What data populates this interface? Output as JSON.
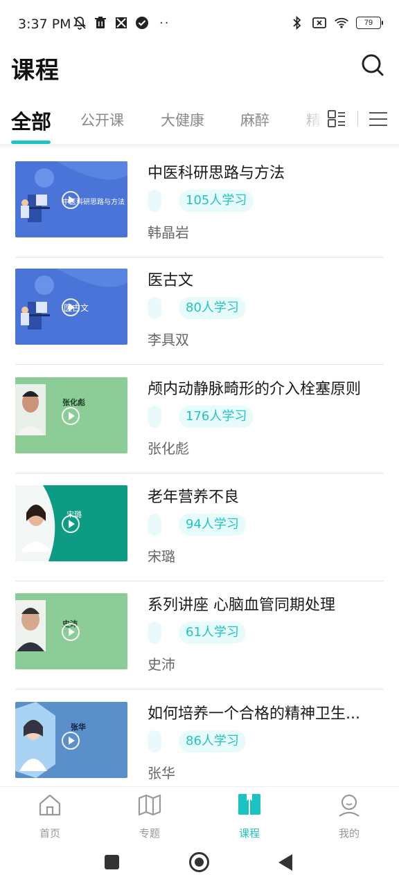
{
  "status_bar": {
    "time": "3:37 PM",
    "left_icons": [
      "mute-icon",
      "trash-icon",
      "app-icon",
      "check-icon"
    ],
    "more": "··",
    "right_icons": [
      "bluetooth-icon",
      "sim-icon",
      "wifi-icon"
    ],
    "battery": "79"
  },
  "header": {
    "title": "课程",
    "search_icon": "search-icon"
  },
  "tabs": [
    {
      "label": "全部",
      "active": true
    },
    {
      "label": "公开课"
    },
    {
      "label": "大健康"
    },
    {
      "label": "麻醉"
    },
    {
      "label": "精"
    }
  ],
  "courses": [
    {
      "title": "中医科研思路与方法",
      "learners": "105人学习",
      "teacher": "韩晶岩",
      "thumb_style": "blue",
      "thumb_text": "中医科研思路与方法"
    },
    {
      "title": "医古文",
      "learners": "80人学习",
      "teacher": "李具双",
      "thumb_style": "blue",
      "thumb_text": "医古文"
    },
    {
      "title": "颅内动静脉畸形的介入栓塞原则",
      "learners": "176人学习",
      "teacher": "张化彪",
      "thumb_style": "green",
      "thumb_text": "张化彪"
    },
    {
      "title": "老年营养不良",
      "learners": "94人学习",
      "teacher": "宋璐",
      "thumb_style": "teal",
      "thumb_text": "宋璐"
    },
    {
      "title": "系列讲座 心脑血管同期处理",
      "learners": "61人学习",
      "teacher": "史沛",
      "thumb_style": "green",
      "thumb_text": "史沛"
    },
    {
      "title": "如何培养一个合格的精神卫生...",
      "learners": "86人学习",
      "teacher": "张华",
      "thumb_style": "steel",
      "thumb_text": "张华"
    }
  ],
  "bottom_nav": [
    {
      "label": "首页",
      "icon": "home-icon"
    },
    {
      "label": "专题",
      "icon": "map-icon"
    },
    {
      "label": "课程",
      "icon": "book-icon",
      "active": true
    },
    {
      "label": "我的",
      "icon": "user-icon"
    }
  ],
  "colors": {
    "accent": "#1cc3c0",
    "thumb_blue": "#4a74d8",
    "thumb_green": "#8ccc96",
    "thumb_teal": "#0d9b84",
    "thumb_steel": "#5b8fc9"
  }
}
